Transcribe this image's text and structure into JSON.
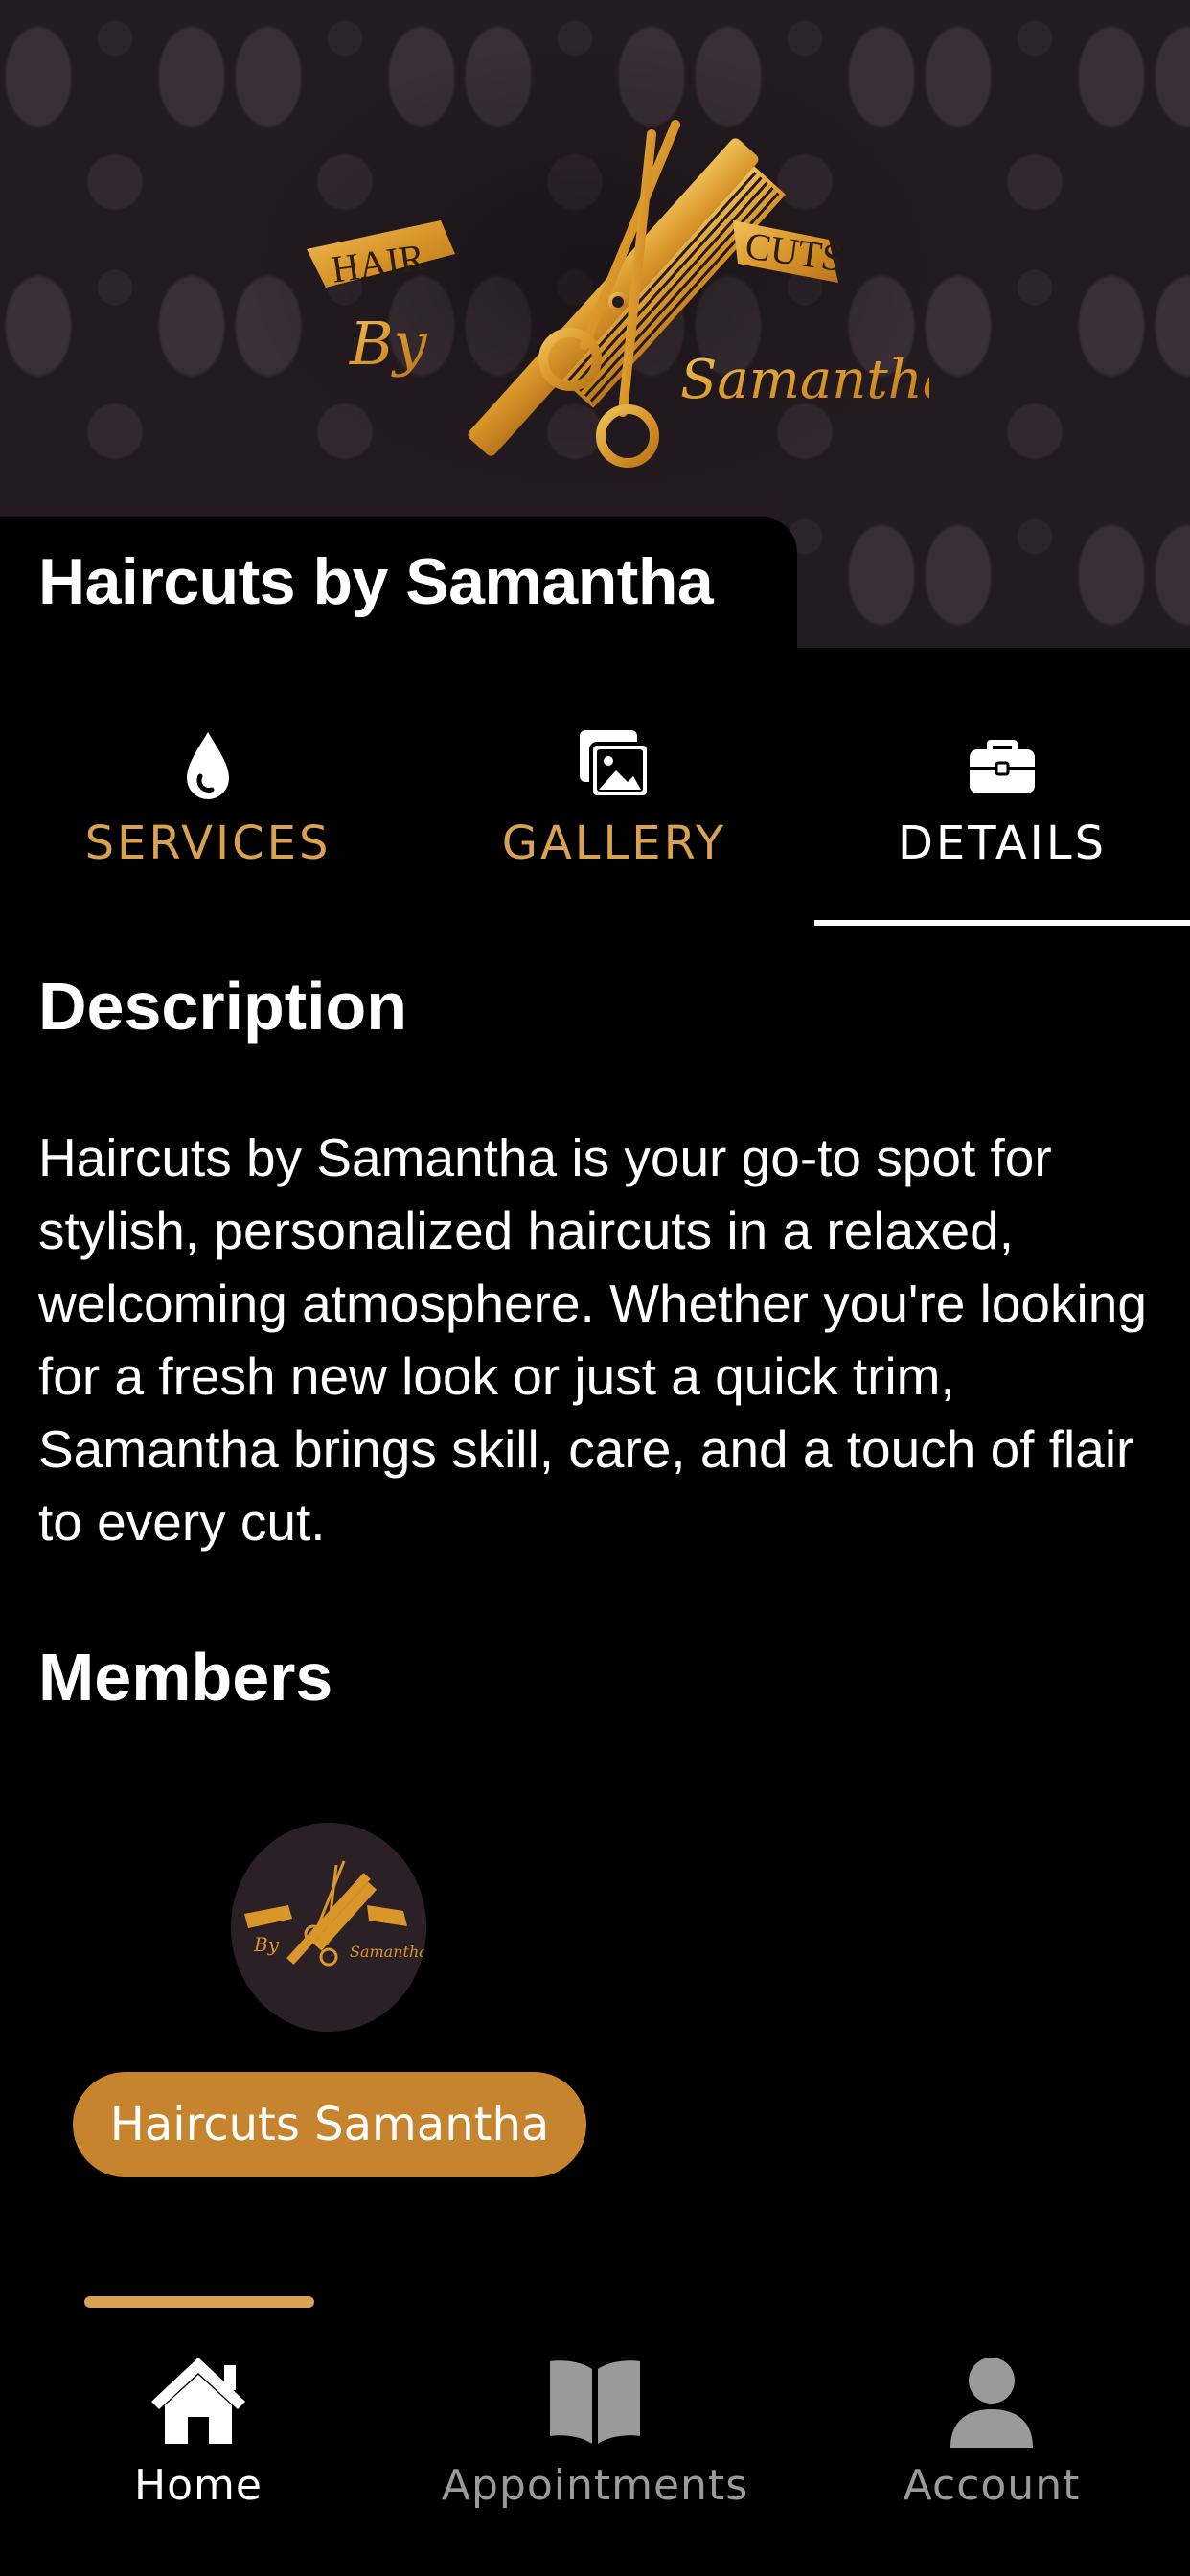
{
  "header": {
    "title": "Haircuts by Samantha",
    "logo_words": [
      "HAIR",
      "CUTS",
      "By",
      "Samantha"
    ]
  },
  "tabs": [
    {
      "label": "SERVICES",
      "icon": "drop-icon",
      "active": false
    },
    {
      "label": "GALLERY",
      "icon": "image-icon",
      "active": false
    },
    {
      "label": "DETAILS",
      "icon": "briefcase-icon",
      "active": true
    }
  ],
  "details": {
    "description_heading": "Description",
    "description": "Haircuts by Samantha is your go-to spot for stylish, personalized haircuts in a relaxed, welcoming atmosphere. Whether you're looking for a fresh new look or just a quick trim, Samantha brings skill, care, and a touch of flair to every cut.",
    "members_heading": "Members",
    "members": [
      {
        "name": "Haircuts Samantha"
      }
    ]
  },
  "nav": [
    {
      "label": "Home",
      "icon": "home-icon",
      "active": true
    },
    {
      "label": "Appointments",
      "icon": "book-icon",
      "active": false
    },
    {
      "label": "Account",
      "icon": "person-icon",
      "active": false
    }
  ],
  "colors": {
    "gold": "#d9a153",
    "chip": "#c7842e",
    "inactive": "#9a9a9a",
    "background": "#000000"
  }
}
